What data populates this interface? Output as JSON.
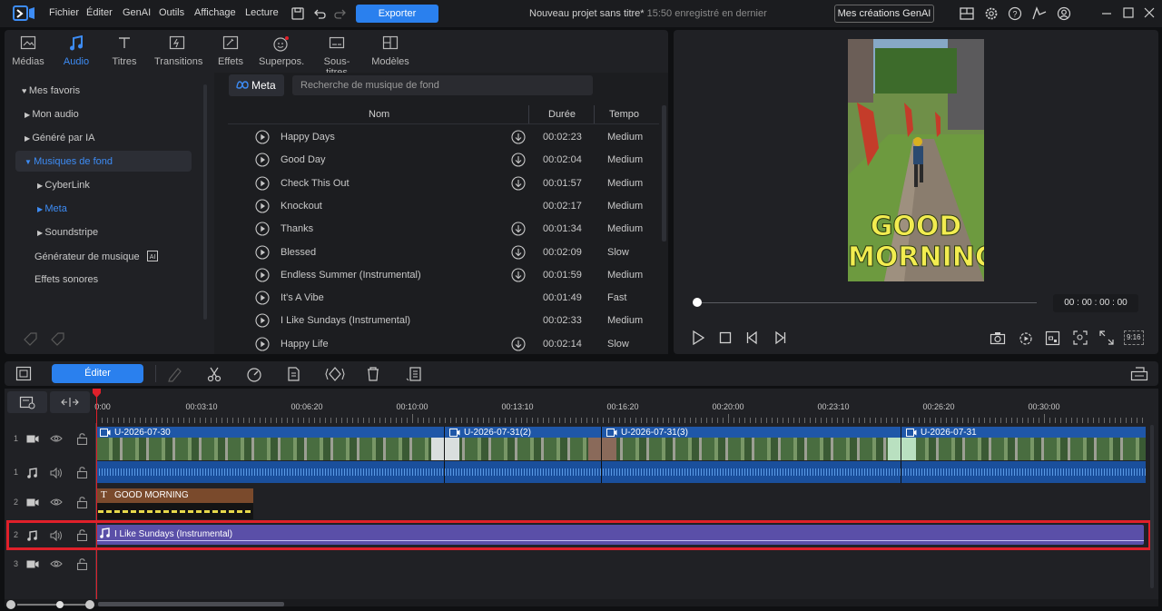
{
  "menu": [
    "Fichier",
    "Éditer",
    "GenAI",
    "Outils",
    "Affichage",
    "Lecture"
  ],
  "export_label": "Exporter",
  "project": {
    "title": "Nouveau projet sans titre*",
    "saved": "15:50 enregistré en dernier"
  },
  "genai_button": "Mes créations GenAI",
  "tabs": [
    "Médias",
    "Audio",
    "Titres",
    "Transitions",
    "Effets",
    "Superpos.",
    "Sous-titres",
    "Modèles"
  ],
  "active_tab": "Audio",
  "sidebar": {
    "favorites": "Mes favoris",
    "my_audio": "Mon audio",
    "ai_generated": "Généré par IA",
    "background_music": "Musiques de fond",
    "cyberlink": "CyberLink",
    "meta": "Meta",
    "soundstripe": "Soundstripe",
    "music_generator": "Générateur de musique",
    "sound_effects": "Effets sonores"
  },
  "source_label": "Meta",
  "search_placeholder": "Recherche de musique de fond",
  "columns": {
    "name": "Nom",
    "duration": "Durée",
    "tempo": "Tempo"
  },
  "tracks": [
    {
      "name": "Happy Days",
      "duration": "00:02:23",
      "tempo": "Medium",
      "download": true
    },
    {
      "name": "Good Day",
      "duration": "00:02:04",
      "tempo": "Medium",
      "download": true
    },
    {
      "name": "Check This Out",
      "duration": "00:01:57",
      "tempo": "Medium",
      "download": true
    },
    {
      "name": "Knockout",
      "duration": "00:02:17",
      "tempo": "Medium",
      "download": false
    },
    {
      "name": "Thanks",
      "duration": "00:01:34",
      "tempo": "Medium",
      "download": true
    },
    {
      "name": "Blessed",
      "duration": "00:02:09",
      "tempo": "Slow",
      "download": true
    },
    {
      "name": "Endless Summer (Instrumental)",
      "duration": "00:01:59",
      "tempo": "Medium",
      "download": true
    },
    {
      "name": "It's A Vibe",
      "duration": "00:01:49",
      "tempo": "Fast",
      "download": false
    },
    {
      "name": "I Like Sundays (Instrumental)",
      "duration": "00:02:33",
      "tempo": "Medium",
      "download": false
    },
    {
      "name": "Happy Life",
      "duration": "00:02:14",
      "tempo": "Slow",
      "download": true
    }
  ],
  "preview": {
    "text_line1": "GOOD",
    "text_line2": "MORNING",
    "timecode": "00 : 00 : 00 : 00",
    "aspect": "9:16"
  },
  "edit_label": "Éditer",
  "ruler": [
    "0:00",
    "00:03:10",
    "00:06:20",
    "00:10:00",
    "00:13:10",
    "00:16:20",
    "00:20:00",
    "00:23:10",
    "00:26:20",
    "00:30:00"
  ],
  "track_numbers": [
    "1",
    "1",
    "2",
    "2",
    "3"
  ],
  "clips": {
    "video": [
      "U-2026-07-30",
      "U-2026-07-31(2)",
      "U-2026-07-31(3)",
      "U-2026-07-31"
    ],
    "title": "GOOD MORNING",
    "music": "I Like Sundays (Instrumental)"
  },
  "colors": {
    "accent": "#2a80ee",
    "highlight": "#e0202a",
    "music_clip": "#5a4fa8",
    "title_clip": "#7a4a2c",
    "video_clip": "#1f57a8"
  }
}
